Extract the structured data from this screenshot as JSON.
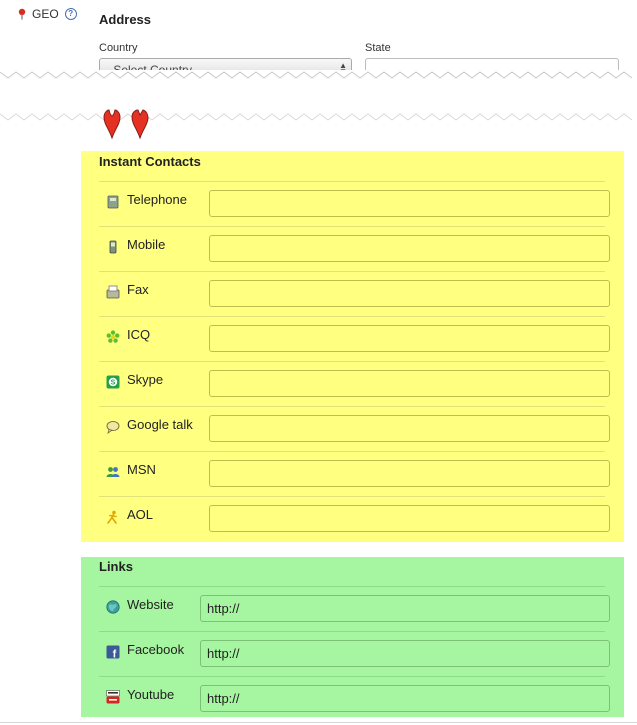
{
  "geo": {
    "label": "GEO",
    "help": "?"
  },
  "address": {
    "title": "Address",
    "country_label": "Country",
    "country_selected": "- Select Country -",
    "state_label": "State",
    "state_value": ""
  },
  "instant": {
    "title": "Instant Contacts",
    "items": [
      {
        "label": "Telephone",
        "icon": "telephone-icon",
        "value": ""
      },
      {
        "label": "Mobile",
        "icon": "mobile-icon",
        "value": ""
      },
      {
        "label": "Fax",
        "icon": "fax-icon",
        "value": ""
      },
      {
        "label": "ICQ",
        "icon": "icq-icon",
        "value": ""
      },
      {
        "label": "Skype",
        "icon": "skype-icon",
        "value": ""
      },
      {
        "label": "Google talk",
        "icon": "google-talk-icon",
        "value": ""
      },
      {
        "label": "MSN",
        "icon": "msn-icon",
        "value": ""
      },
      {
        "label": "AOL",
        "icon": "aol-icon",
        "value": ""
      }
    ]
  },
  "links": {
    "title": "Links",
    "items": [
      {
        "label": "Website",
        "icon": "globe-icon",
        "value": "http://"
      },
      {
        "label": "Facebook",
        "icon": "facebook-icon",
        "value": "http://"
      },
      {
        "label": "Youtube",
        "icon": "youtube-icon",
        "value": "http://"
      }
    ]
  },
  "colors": {
    "instant_bg": "#ffff80",
    "links_bg": "#a6f5a0",
    "accent_red": "#d92b20"
  }
}
